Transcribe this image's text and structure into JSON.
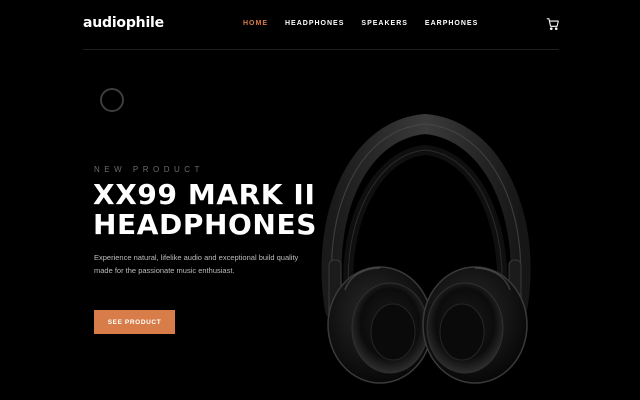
{
  "header": {
    "logo": "audiophile",
    "nav": [
      {
        "label": "HOME",
        "active": true
      },
      {
        "label": "HEADPHONES",
        "active": false
      },
      {
        "label": "SPEAKERS",
        "active": false
      },
      {
        "label": "EARPHONES",
        "active": false
      }
    ],
    "cart_icon": "cart-icon"
  },
  "hero": {
    "eyebrow": "NEW PRODUCT",
    "title_line1": "XX99 MARK II",
    "title_line2": "HEADPHONES",
    "description": "Experience natural, lifelike audio and exceptional build quality made for the passionate music enthusiast.",
    "cta_label": "SEE PRODUCT",
    "image_icon": "headphones-image"
  },
  "colors": {
    "accent": "#d87d4a",
    "background": "#000000",
    "text": "#ffffff",
    "muted": "#bcbcbc"
  }
}
